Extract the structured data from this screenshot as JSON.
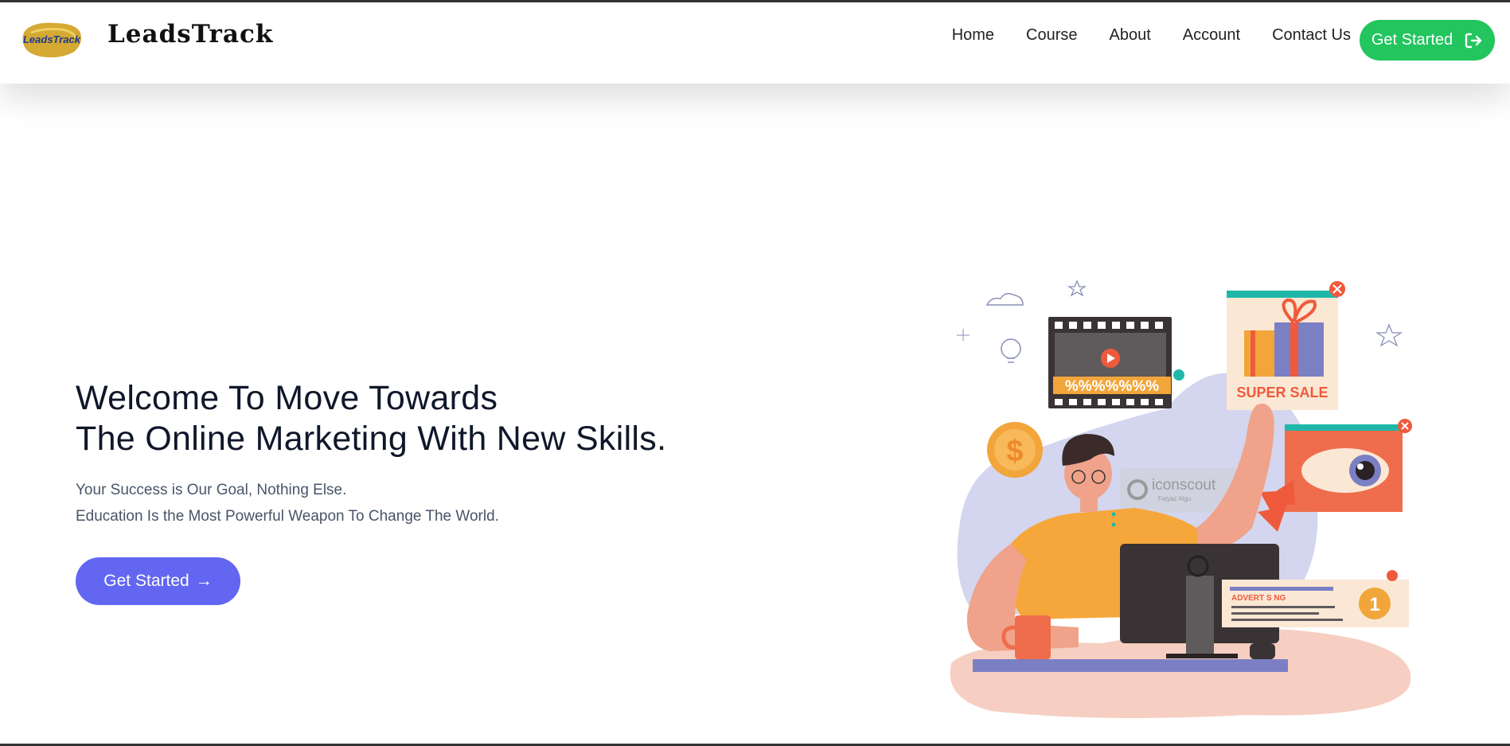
{
  "nav": {
    "logo_text": "LeadsTrack",
    "brand": "LeadsTrack",
    "links": [
      "Home",
      "Course",
      "About",
      "Account",
      "Contact Us"
    ],
    "cta_label": "Get Started",
    "cta_icon": "sign-in-icon"
  },
  "hero": {
    "title_line1": "Welcome To Move Towards",
    "title_line2": "The Online Marketing With New Skills.",
    "subtitle_line1": "Your Success is Our Goal, Nothing Else.",
    "subtitle_line2": "Education Is the Most Powerful Weapon To Change The World.",
    "cta_label": "Get Started",
    "cta_arrow": "→"
  },
  "illustration": {
    "super_sale": "SUPER SALE",
    "percent_banner": "%%%%%%%",
    "advertising": "ADVERT S NG",
    "badge_number": "1",
    "coin_symbol": "$",
    "watermark_brand": "iconscout",
    "watermark_author": "Faiyaz Algu"
  },
  "colors": {
    "nav_cta": "#22c55e",
    "hero_cta": "#6366f1",
    "title": "#0f172a",
    "subtitle": "#475569"
  }
}
